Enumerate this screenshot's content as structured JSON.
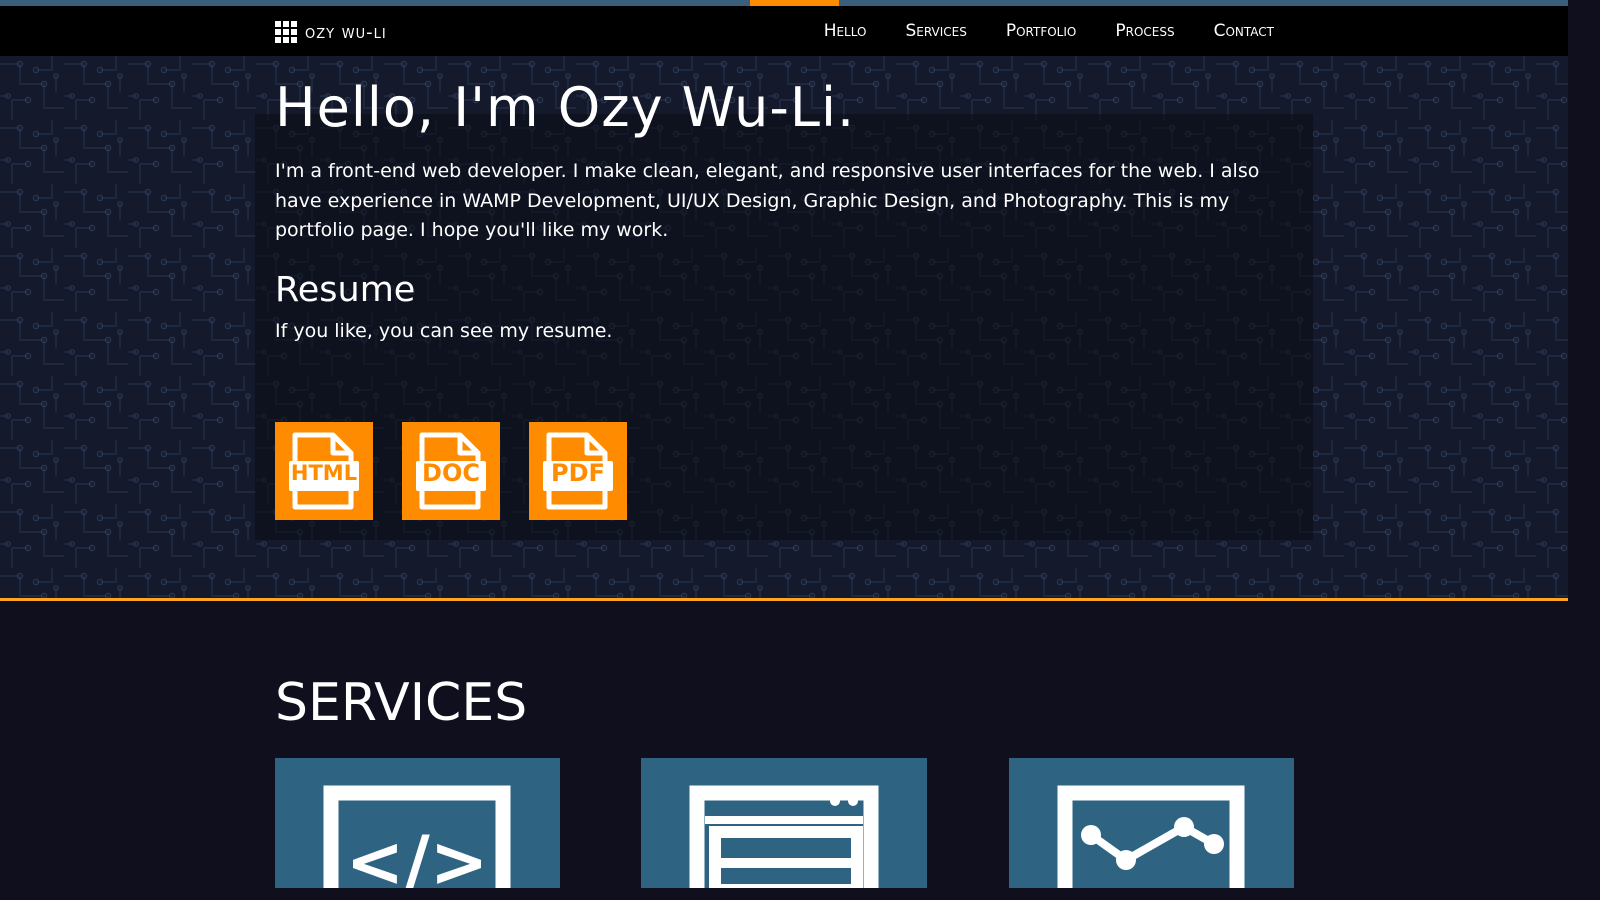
{
  "brand": {
    "name": "ozy wu-li",
    "icon": "grid-icon"
  },
  "nav": {
    "items": [
      {
        "label": "Hello",
        "active": true
      },
      {
        "label": "Services",
        "active": false
      },
      {
        "label": "Portfolio",
        "active": false
      },
      {
        "label": "Process",
        "active": false
      },
      {
        "label": "Contact",
        "active": false
      }
    ]
  },
  "hero": {
    "title": "Hello, I'm Ozy Wu-Li.",
    "description": "I'm a front-end web developer. I make clean, elegant, and responsive user interfaces for the web. I also have experience in WAMP Development, UI/UX Design, Graphic Design, and Photography. This is my portfolio page. I hope you'll like my work.",
    "resume_title": "Resume",
    "resume_description": "If you like, you can see my resume.",
    "resume_files": [
      {
        "label": "HTML",
        "icon": "html-file-icon"
      },
      {
        "label": "DOC",
        "icon": "doc-file-icon"
      },
      {
        "label": "PDF",
        "icon": "pdf-file-icon"
      }
    ]
  },
  "services": {
    "title": "SERVICES",
    "cards": [
      {
        "icon": "code-icon"
      },
      {
        "icon": "browser-layout-icon"
      },
      {
        "icon": "line-graph-icon"
      }
    ]
  },
  "colors": {
    "accent": "#ff8c00",
    "divider": "#ffa51f",
    "top_bar": "#3a5f7d",
    "navbar": "#000000",
    "hero_bg": "#141a2b",
    "section_bg": "#0f0f1e",
    "card_bg": "#2e6482"
  }
}
